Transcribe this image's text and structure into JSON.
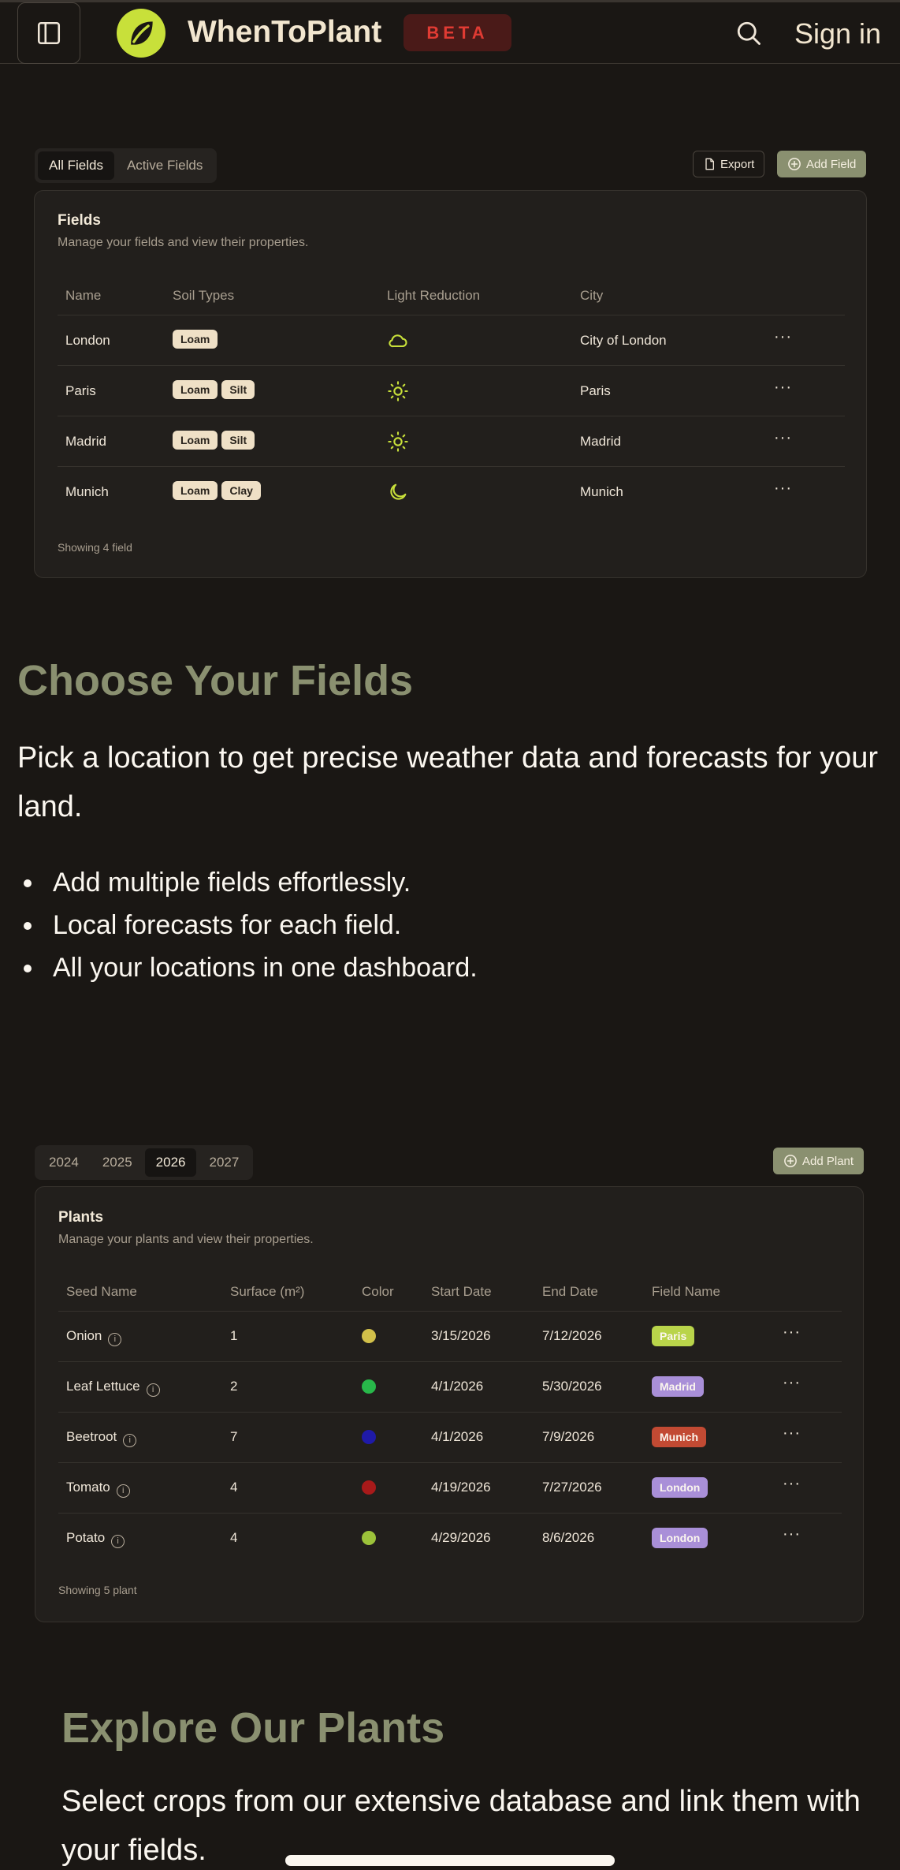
{
  "header": {
    "brand": "WhenToPlant",
    "badge": "BETA",
    "signin_label": "Sign in"
  },
  "fields_section": {
    "tabs": [
      {
        "label": "All Fields",
        "active": true
      },
      {
        "label": "Active Fields",
        "active": false
      }
    ],
    "export_label": "Export",
    "add_label": "Add Field",
    "card": {
      "title": "Fields",
      "subtitle": "Manage your fields and view their properties.",
      "columns": [
        "Name",
        "Soil Types",
        "Light Reduction",
        "City"
      ],
      "rows": [
        {
          "name": "London",
          "soils": [
            "Loam"
          ],
          "light_icon": "cloud-icon",
          "city": "City of London"
        },
        {
          "name": "Paris",
          "soils": [
            "Loam",
            "Silt"
          ],
          "light_icon": "sun-icon",
          "city": "Paris"
        },
        {
          "name": "Madrid",
          "soils": [
            "Loam",
            "Silt"
          ],
          "light_icon": "sun-icon",
          "city": "Madrid"
        },
        {
          "name": "Munich",
          "soils": [
            "Loam",
            "Clay"
          ],
          "light_icon": "moon-icon",
          "city": "Munich"
        }
      ],
      "footer": "Showing 4 field"
    }
  },
  "choose": {
    "heading": "Choose Your Fields",
    "paragraph": "Pick a location to get precise weather data and forecasts for your land.",
    "bullets": [
      "Add multiple fields effortlessly.",
      "Local forecasts for each field.",
      "All your locations in one dashboard."
    ]
  },
  "plants_section": {
    "years": [
      {
        "label": "2024",
        "active": false
      },
      {
        "label": "2025",
        "active": false
      },
      {
        "label": "2026",
        "active": true
      },
      {
        "label": "2027",
        "active": false
      }
    ],
    "add_label": "Add Plant",
    "card": {
      "title": "Plants",
      "subtitle": "Manage your plants and view their properties.",
      "columns": [
        "Seed Name",
        "Surface (m²)",
        "Color",
        "Start Date",
        "End Date",
        "Field Name"
      ],
      "rows": [
        {
          "seed": "Onion",
          "surface": "1",
          "color": "#d2c04a",
          "start": "3/15/2026",
          "end": "7/12/2026",
          "field": "Paris",
          "field_color": "#b9d44a"
        },
        {
          "seed": "Leaf Lettuce",
          "surface": "2",
          "color": "#28b84a",
          "start": "4/1/2026",
          "end": "5/30/2026",
          "field": "Madrid",
          "field_color": "#a98fd8"
        },
        {
          "seed": "Beetroot",
          "surface": "7",
          "color": "#1f1aa8",
          "start": "4/1/2026",
          "end": "7/9/2026",
          "field": "Munich",
          "field_color": "#c24a33"
        },
        {
          "seed": "Tomato",
          "surface": "4",
          "color": "#a81a1a",
          "start": "4/19/2026",
          "end": "7/27/2026",
          "field": "London",
          "field_color": "#a98fd8"
        },
        {
          "seed": "Potato",
          "surface": "4",
          "color": "#9cc23a",
          "start": "4/29/2026",
          "end": "8/6/2026",
          "field": "London",
          "field_color": "#a98fd8"
        }
      ],
      "footer": "Showing 5 plant"
    }
  },
  "explore": {
    "heading": "Explore Our Plants",
    "paragraph": "Select crops from our extensive database and link them with your fields."
  }
}
